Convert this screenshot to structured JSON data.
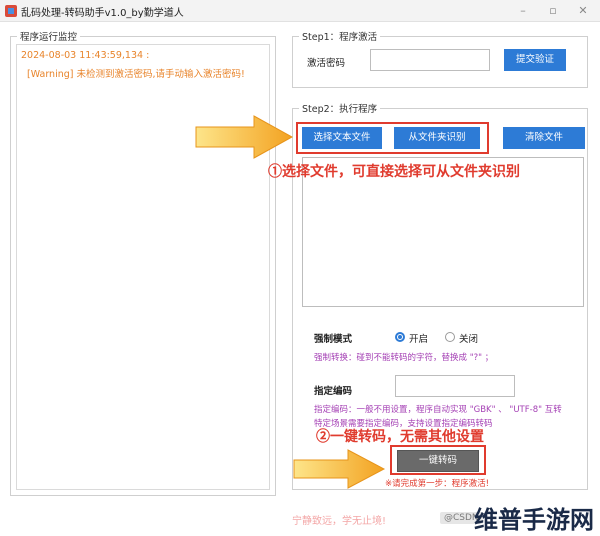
{
  "window": {
    "title": "乱码处理-转码助手v1.0_by勤学道人",
    "minimize": "–",
    "maximize": "▫",
    "close": "✕"
  },
  "monitor": {
    "group_label": "程序运行监控",
    "log_lines": [
      "2024-08-03 11:43:59,134 :",
      "[Warning] 未检测到激活密码,请手动输入激活密码!"
    ]
  },
  "step1": {
    "group_label": "Step1：程序激活",
    "password_label": "激活密码",
    "password_value": "",
    "submit_label": "提交验证"
  },
  "step2": {
    "group_label": "Step2：执行程序",
    "select_file_label": "选择文本文件",
    "from_folder_label": "从文件夹识别",
    "clear_label": "清除文件",
    "annotation1": "①选择文件，可直接选择可从文件夹识别",
    "force_mode_label": "强制模式",
    "option_on": "开启",
    "option_off": "关闭",
    "force_mode_value": "开启",
    "force_hint": "强制转换：碰到不能转码的字符，替换成 \"?\" ；",
    "encoding_label": "指定编码",
    "encoding_value": "",
    "encoding_hint1": "指定编码：一般不用设置，程序自动实现 \"GBK\" 、 \"UTF-8\" 互转",
    "encoding_hint2": "特定场景需要指定编码，支持设置指定编码转码",
    "annotation2": "②一键转码，无需其他设置",
    "convert_label": "一键转码",
    "warning": "※请完成第一步：程序激活!"
  },
  "footer": {
    "motto": "宁静致远，学无止境!",
    "watermark": "维普手游网",
    "watermark_chip": "@CSDN"
  },
  "colors": {
    "accent_blue": "#2d7bd6",
    "annotation_red": "#e03b2e",
    "log_orange": "#e8842b",
    "hint_purple": "#a541b5"
  }
}
